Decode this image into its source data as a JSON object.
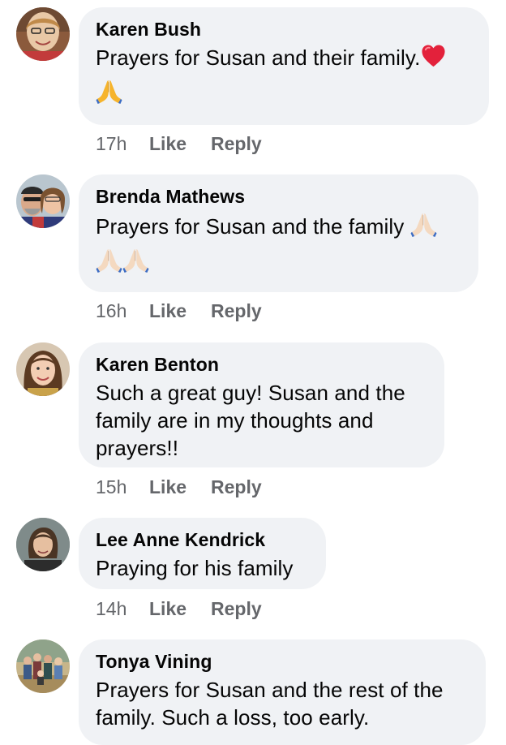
{
  "actions": {
    "like_label": "Like",
    "reply_label": "Reply"
  },
  "comments": [
    {
      "author": "Karen Bush",
      "text": "Prayers for Susan and their family.",
      "emoji": [
        "red-heart",
        "folded-hands"
      ],
      "time": "17h"
    },
    {
      "author": "Brenda Mathews",
      "text": "Prayers for Susan and the family",
      "emoji": [
        "folded-hands",
        "folded-hands",
        "folded-hands"
      ],
      "time": "16h"
    },
    {
      "author": "Karen Benton",
      "text": "Such a great guy! Susan and the family are in my thoughts and prayers!!",
      "time": "15h"
    },
    {
      "author": "Lee Anne Kendrick",
      "text": "Praying for his family",
      "time": "14h"
    },
    {
      "author": "Tonya Vining",
      "text": "Prayers for Susan and the rest of the family. Such a loss, too early."
    }
  ],
  "colors": {
    "bubble": "#f0f2f5",
    "secondary_text": "#65676b",
    "heart": "#e0245e",
    "folded_hands_gold": "#f5b82e",
    "folded_hands_light": "#f3d9c2"
  }
}
